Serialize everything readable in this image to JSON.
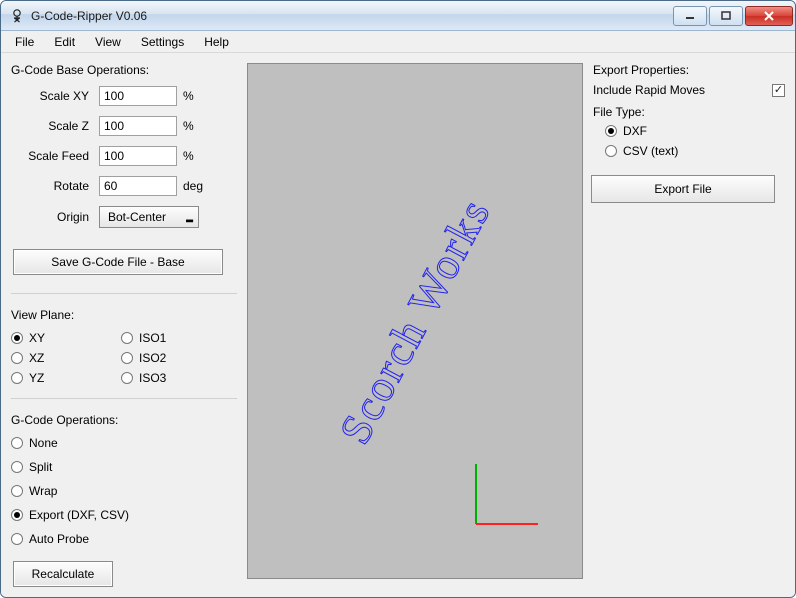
{
  "window": {
    "title": "G-Code-Ripper V0.06"
  },
  "menu": {
    "file": "File",
    "edit": "Edit",
    "view": "View",
    "settings": "Settings",
    "help": "Help"
  },
  "left": {
    "base_heading": "G-Code Base Operations:",
    "scale_xy": {
      "label": "Scale XY",
      "value": "100",
      "unit": "%"
    },
    "scale_z": {
      "label": "Scale Z",
      "value": "100",
      "unit": "%"
    },
    "scale_feed": {
      "label": "Scale Feed",
      "value": "100",
      "unit": "%"
    },
    "rotate": {
      "label": "Rotate",
      "value": "60",
      "unit": "deg"
    },
    "origin": {
      "label": "Origin",
      "value": "Bot-Center"
    },
    "save_base_btn": "Save G-Code File - Base",
    "view_plane_heading": "View Plane:",
    "vp": {
      "xy": "XY",
      "xz": "XZ",
      "yz": "YZ",
      "iso1": "ISO1",
      "iso2": "ISO2",
      "iso3": "ISO3"
    },
    "ops_heading": "G-Code Operations:",
    "ops": {
      "none": "None",
      "split": "Split",
      "wrap": "Wrap",
      "export": "Export (DXF, CSV)",
      "autoprobe": "Auto Probe"
    },
    "recalc_btn": "Recalculate"
  },
  "right": {
    "export_heading": "Export Properties:",
    "include_rapid": "Include Rapid Moves",
    "file_type_heading": "File Type:",
    "ft": {
      "dxf": "DXF",
      "csv": "CSV (text)"
    },
    "export_btn": "Export File"
  },
  "canvas": {
    "text": "Scorch Works"
  }
}
